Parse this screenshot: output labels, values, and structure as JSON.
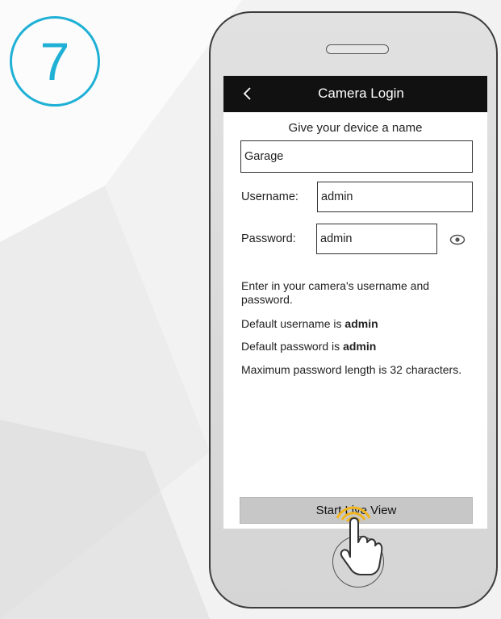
{
  "step": {
    "number": "7"
  },
  "screen": {
    "title": "Camera Login",
    "heading": "Give your device a name",
    "device_name_value": "Garage",
    "username_label": "Username:",
    "username_value": "admin",
    "password_label": "Password:",
    "password_value": "admin",
    "info_line1": "Enter in your camera's username and password.",
    "info_line2_prefix": "Default username is ",
    "info_line2_value": "admin",
    "info_line3_prefix": "Default password is ",
    "info_line3_value": "admin",
    "info_line4": "Maximum password length is 32 characters.",
    "start_button": "Start Live View"
  },
  "icons": {
    "back": "chevron-left-icon",
    "eye": "eye-icon",
    "tap": "tap-hand-icon"
  },
  "colors": {
    "accent": "#1fb0d6",
    "titlebar": "#111111",
    "button": "#c7c7c7",
    "tap_glow": "#f2b51c"
  }
}
